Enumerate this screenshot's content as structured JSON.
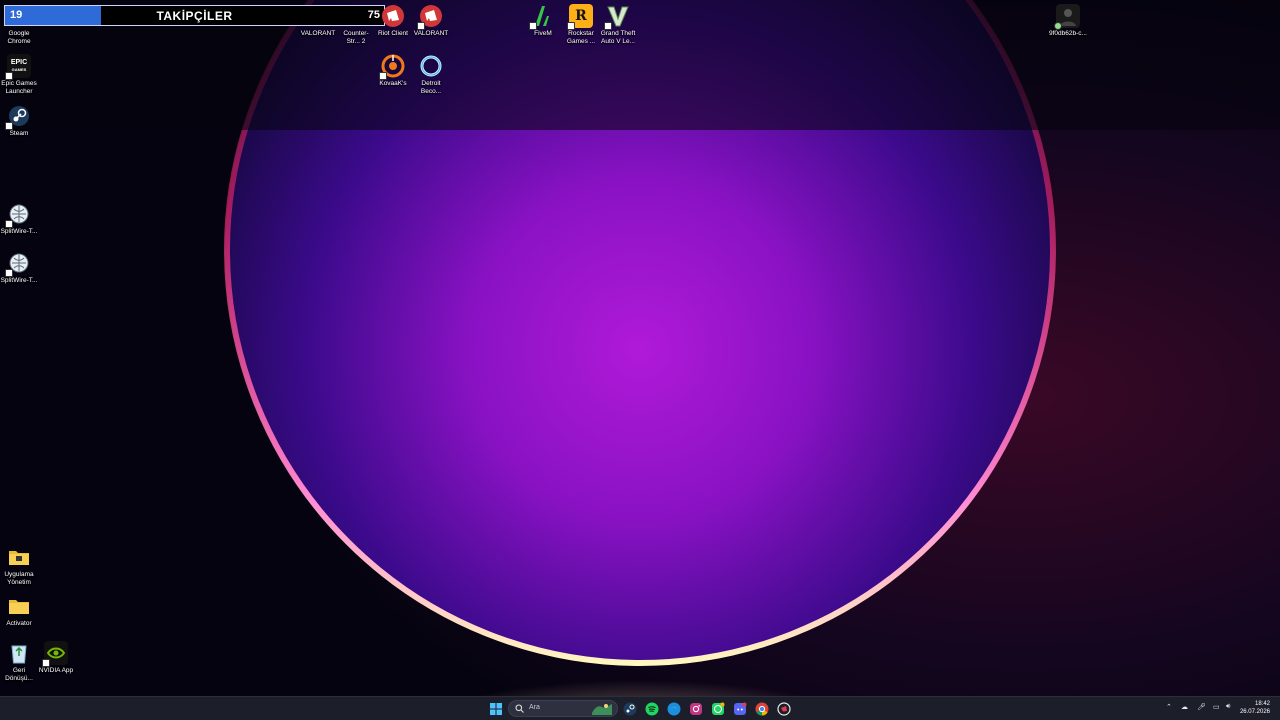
{
  "follower_widget": {
    "count": "19",
    "title": "TAKİPÇİLER",
    "goal": "75",
    "progress": 0.253
  },
  "desktop_icons": [
    {
      "label": "Google Chrome",
      "icon": "chrome-icon"
    },
    {
      "label": "Epic Games Launcher",
      "icon": "epic-games-icon"
    },
    {
      "label": "Steam",
      "icon": "steam-icon"
    },
    {
      "label": "SplitWire-T...",
      "icon": "splitwire-icon"
    },
    {
      "label": "SplitWire-T...",
      "icon": "splitwire-icon"
    },
    {
      "label": "Uygulama Yönetim",
      "icon": "folder-icon"
    },
    {
      "label": "Activator",
      "icon": "folder-icon"
    },
    {
      "label": "Geri Dönüşü...",
      "icon": "recycle-bin-icon"
    },
    {
      "label": "NVIDIA App",
      "icon": "nvidia-icon"
    },
    {
      "label": "VALORANT",
      "icon": "valorant-icon"
    },
    {
      "label": "Counter-Str... 2",
      "icon": "counter-strike-icon"
    },
    {
      "label": "Riot Client",
      "icon": "riot-client-icon"
    },
    {
      "label": "VALORANT",
      "icon": "riot-client-icon"
    },
    {
      "label": "KovaaK's",
      "icon": "kovaaks-icon"
    },
    {
      "label": "Detroit Beco...",
      "icon": "detroit-icon"
    },
    {
      "label": "FiveM",
      "icon": "fivem-icon"
    },
    {
      "label": "Rockstar Games ...",
      "icon": "rockstar-icon"
    },
    {
      "label": "Grand Theft Auto V Le...",
      "icon": "gta-icon"
    },
    {
      "label": "9f0db62b-c...",
      "icon": "image-file-icon"
    }
  ],
  "taskbar": {
    "search_placeholder": "Ara",
    "pinned": [
      "windows-start-icon",
      "search-icon",
      "steam-icon",
      "spotify-icon",
      "edge-icon",
      "instagram-icon",
      "whatsapp-icon",
      "discord-icon",
      "chrome-icon",
      "riot-icon"
    ],
    "clock_time": "18:42",
    "clock_date": "26.07.2026"
  },
  "colors": {
    "follower_fill": "#2f6bd8",
    "taskbar_bg": "#1c1e2a"
  }
}
